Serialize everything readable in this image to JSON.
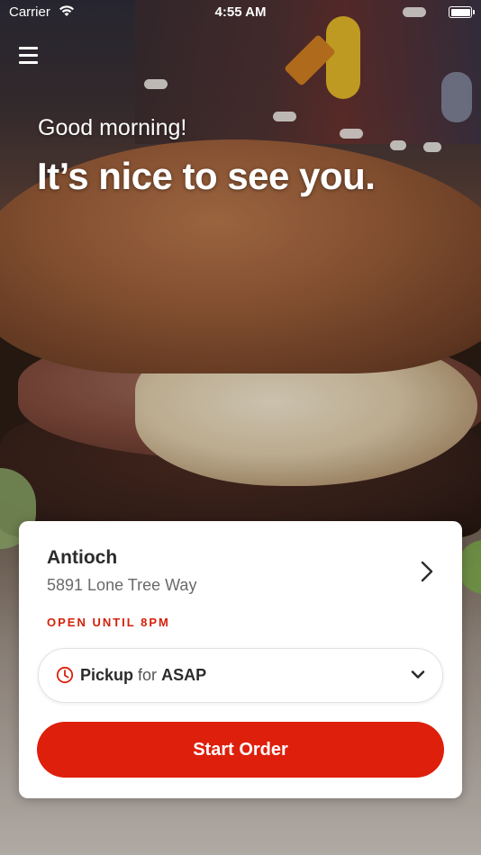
{
  "status_bar": {
    "carrier": "Carrier",
    "time": "4:55 AM",
    "wifi_icon": "wifi-icon",
    "battery_icon": "battery-icon"
  },
  "header": {
    "menu_icon": "hamburger-menu-icon",
    "greeting": "Good morning!",
    "headline": "It’s nice to see you."
  },
  "location_card": {
    "name": "Antioch",
    "address": "5891 Lone Tree Way",
    "status": "OPEN UNTIL 8PM",
    "chevron_icon": "chevron-right-icon",
    "pickup": {
      "mode": "Pickup",
      "connector": "for",
      "time": "ASAP",
      "clock_icon": "clock-icon",
      "dropdown_icon": "chevron-down-icon"
    },
    "start_button": "Start Order"
  },
  "colors": {
    "accent": "#de1f0b",
    "text_dark": "#2b2b2b",
    "text_muted": "#6a6a6a"
  },
  "background": {
    "image_subject": "close-up burger photo"
  }
}
